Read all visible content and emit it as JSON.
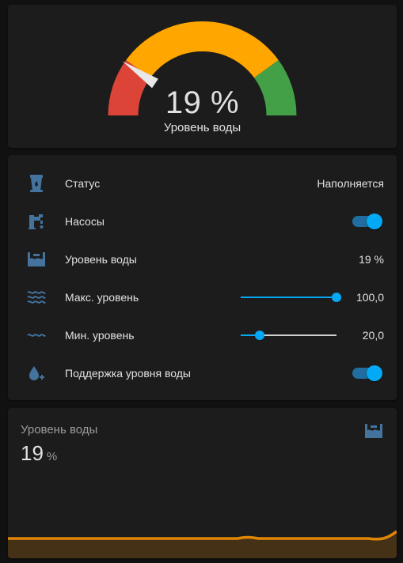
{
  "gauge": {
    "value": 19,
    "display": "19 %",
    "name": "Уровень воды",
    "min": 0,
    "max": 100,
    "severity": {
      "red_to": 20,
      "yellow_to": 80,
      "colors": {
        "red": "#db4437",
        "yellow": "#ffa600",
        "green": "#43a047"
      }
    }
  },
  "entities": {
    "rows": [
      {
        "icon": "water-tank-icon",
        "label": "Статус",
        "state": "Наполняется"
      },
      {
        "icon": "water-pump-icon",
        "label": "Насосы",
        "toggle": true
      },
      {
        "icon": "water-level-icon",
        "label": "Уровень воды",
        "state": "19 %"
      },
      {
        "icon": "waves-icon",
        "label": "Макс. уровень",
        "state": "100,0",
        "slider_value": 100
      },
      {
        "icon": "wave-icon",
        "label": "Мин. уровень",
        "state": "20,0",
        "slider_value": 20
      },
      {
        "icon": "water-plus-icon",
        "label": "Поддержка уровня воды",
        "toggle": true
      }
    ]
  },
  "sensor": {
    "name": "Уровень воды",
    "value": "19",
    "unit": "%",
    "icon": "water-level-icon"
  },
  "colors": {
    "accent": "#03a9f4",
    "icon": "#44739e",
    "graph": "#ff9800"
  }
}
